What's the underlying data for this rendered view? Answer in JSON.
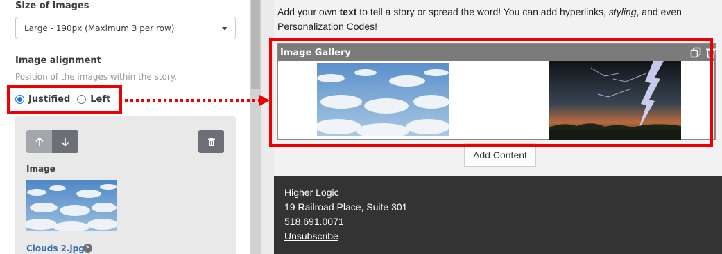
{
  "settings": {
    "size_label": "Size of images",
    "size_value": "Large - 190px (Maximum 3 per row)",
    "alignment_label": "Image alignment",
    "alignment_help": "Position of the images within the story.",
    "alignment_options": [
      "Justified",
      "Left"
    ],
    "alignment_selected": "Justified"
  },
  "image_card": {
    "label": "Image",
    "file_name": "Clouds 2.jpg",
    "icons": [
      "arrow-up-icon",
      "arrow-down-icon",
      "trash-icon",
      "remove-icon"
    ]
  },
  "preview": {
    "story_text": {
      "part1": "Add your own ",
      "bold": "text",
      "part2": " to tell a story or spread the word! You can add hyperlinks, ",
      "italic": "styling",
      "part3": ", and even Personalization Codes!"
    },
    "gallery_title": "Image Gallery",
    "gallery_icons": [
      "copy-icon",
      "trash-icon"
    ],
    "add_content_label": "Add Content"
  },
  "footer": {
    "org": "Higher Logic",
    "address": "19 Railroad Place, Suite 301",
    "phone": "518.691.0071",
    "unsubscribe": "Unsubscribe"
  },
  "colors": {
    "highlight": "#ee0000",
    "radio_accent": "#1a73e8",
    "gallery_header": "#7b7b7b",
    "footer_bg": "#333333",
    "file_link": "#3a6fb5"
  }
}
